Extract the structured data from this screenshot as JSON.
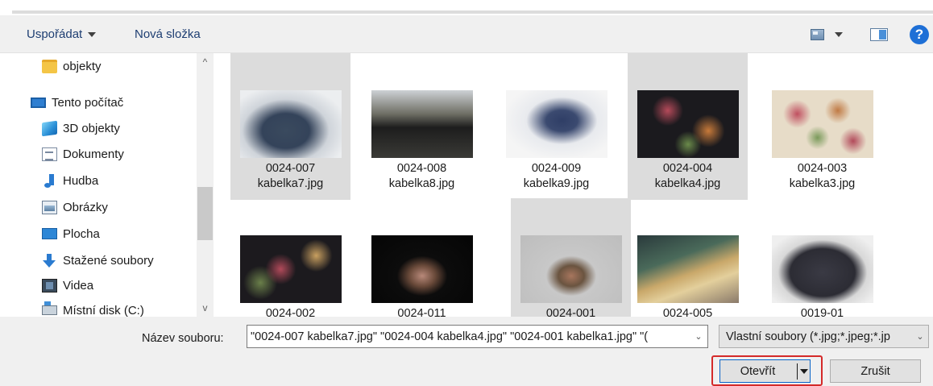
{
  "toolbar": {
    "organize_label": "Uspořádat",
    "new_folder_label": "Nová složka",
    "view_icon": "view-options-icon",
    "preview_icon": "preview-pane-icon",
    "help_icon": "help-icon",
    "help_glyph": "?"
  },
  "nav": {
    "items": [
      {
        "label": "objekty",
        "icon": "folder-icon"
      },
      {
        "label": "Tento počítač",
        "icon": "computer-icon"
      },
      {
        "label": "3D objekty",
        "icon": "3d-objects-icon"
      },
      {
        "label": "Dokumenty",
        "icon": "documents-icon"
      },
      {
        "label": "Hudba",
        "icon": "music-icon"
      },
      {
        "label": "Obrázky",
        "icon": "pictures-icon"
      },
      {
        "label": "Plocha",
        "icon": "desktop-icon"
      },
      {
        "label": "Stažené soubory",
        "icon": "downloads-icon"
      },
      {
        "label": "Videa",
        "icon": "videos-icon"
      },
      {
        "label": "Místní disk (C:)",
        "icon": "local-disk-icon"
      }
    ],
    "scroll_up": "^",
    "scroll_down": "v"
  },
  "files": {
    "row1": [
      {
        "line1": "0024-007",
        "line2": "kabelka7.jpg",
        "selected": true
      },
      {
        "line1": "0024-008",
        "line2": "kabelka8.jpg",
        "selected": false
      },
      {
        "line1": "0024-009",
        "line2": "kabelka9.jpg",
        "selected": false
      },
      {
        "line1": "0024-004",
        "line2": "kabelka4.jpg",
        "selected": true
      },
      {
        "line1": "0024-003",
        "line2": "kabelka3.jpg",
        "selected": false
      }
    ],
    "row2": [
      {
        "line1": "0024-002",
        "selected": false
      },
      {
        "line1": "0024-011",
        "selected": false
      },
      {
        "line1": "0024-001",
        "selected": true
      },
      {
        "line1": "0024-005",
        "selected": false
      },
      {
        "line1": "0019-01",
        "selected": false
      }
    ]
  },
  "bottom": {
    "filename_label": "Název souboru:",
    "filename_value": "\"0024-007 kabelka7.jpg\" \"0024-004 kabelka4.jpg\" \"0024-001 kabelka1.jpg\" \"(",
    "filetype_value": "Vlastní soubory (*.jpg;*.jpeg;*.jp",
    "open_label": "Otevřít",
    "cancel_label": "Zrušit"
  },
  "colors": {
    "accent": "#1e6fd6",
    "selection": "#dcdcdc",
    "highlight_border": "#d42a2a"
  }
}
